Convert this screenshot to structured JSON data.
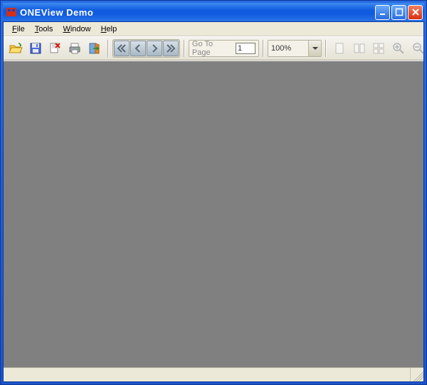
{
  "window": {
    "title": "ONEView Demo"
  },
  "menu": {
    "file": "File",
    "tools": "Tools",
    "window": "Window",
    "help": "Help"
  },
  "toolbar": {
    "goto_label": "Go To Page",
    "goto_value": "1",
    "zoom_value": "100%"
  }
}
